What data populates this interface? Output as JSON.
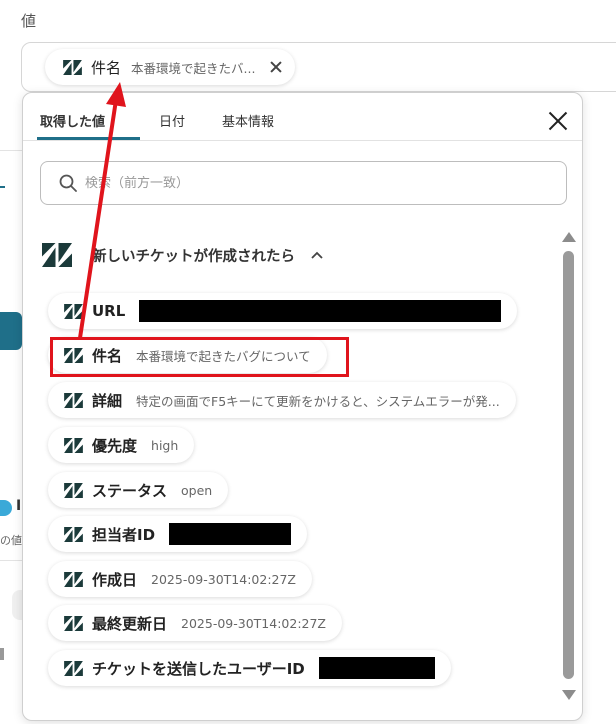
{
  "field": {
    "label": "値"
  },
  "selected_chip": {
    "key": "件名",
    "value": "本番環境で起きたバ..."
  },
  "popover": {
    "tabs": [
      {
        "label": "取得した値",
        "active": true
      },
      {
        "label": "日付",
        "active": false
      },
      {
        "label": "基本情報",
        "active": false
      }
    ],
    "search_placeholder": "検索（前方一致）",
    "section_title": "新しいチケットが作成されたら",
    "items": [
      {
        "key": "URL",
        "value": "",
        "redacted": true
      },
      {
        "key": "件名",
        "value": "本番環境で起きたバグについて",
        "redacted": false,
        "highlighted": true
      },
      {
        "key": "詳細",
        "value": "特定の画面でF5キーにて更新をかけると、システムエラーが発...",
        "redacted": false
      },
      {
        "key": "優先度",
        "value": "high",
        "redacted": false
      },
      {
        "key": "ステータス",
        "value": "open",
        "redacted": false
      },
      {
        "key": "担当者ID",
        "value": "",
        "redacted": true
      },
      {
        "key": "作成日",
        "value": "2025-09-30T14:02:27Z",
        "redacted": false
      },
      {
        "key": "最終更新日",
        "value": "2025-09-30T14:02:27Z",
        "redacted": false
      },
      {
        "key": "チケットを送信したユーザーID",
        "value": "",
        "redacted": true
      }
    ]
  },
  "background": {
    "partial_text_1": "の値",
    "partial_text_2": "I"
  },
  "colors": {
    "accent": "#1f6f89",
    "annotation_red": "#e0141c",
    "zendesk_icon": "#1b3a3a"
  },
  "icons": {
    "service": "zendesk-icon",
    "close": "close-icon",
    "search": "search-icon",
    "collapse": "chevron-up-icon"
  }
}
